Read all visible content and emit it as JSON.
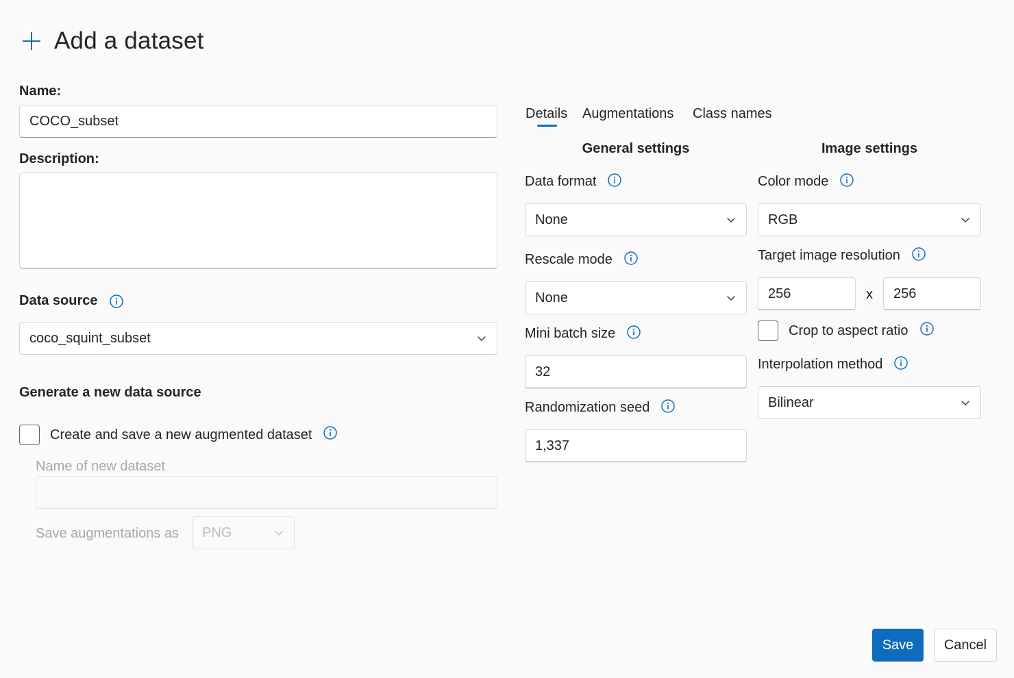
{
  "dialog": {
    "title": "Add a dataset",
    "icon": "plus-icon"
  },
  "left": {
    "name_label": "Name:",
    "name_value": "COCO_subset",
    "description_label": "Description:",
    "description_value": "",
    "data_source_label": "Data source",
    "data_source_value": "coco_squint_subset",
    "generate_heading": "Generate a new data source",
    "create_checkbox_label": "Create and save a new augmented dataset",
    "create_checkbox_checked": false,
    "new_name_label": "Name of new dataset",
    "new_name_value": "",
    "save_as_label": "Save augmentations as",
    "save_as_value": "PNG"
  },
  "tabs": [
    {
      "label": "Details",
      "selected": true
    },
    {
      "label": "Augmentations",
      "selected": false
    },
    {
      "label": "Class names",
      "selected": false
    }
  ],
  "general": {
    "heading": "General settings",
    "data_format_label": "Data format",
    "data_format_value": "None",
    "rescale_mode_label": "Rescale mode",
    "rescale_mode_value": "None",
    "mini_batch_label": "Mini batch size",
    "mini_batch_value": "32",
    "seed_label": "Randomization seed",
    "seed_value": "1,337"
  },
  "image": {
    "heading": "Image settings",
    "color_mode_label": "Color mode",
    "color_mode_value": "RGB",
    "resolution_label": "Target image resolution",
    "resolution_width": "256",
    "resolution_sep": "x",
    "resolution_height": "256",
    "crop_label": "Crop to aspect ratio",
    "crop_checked": false,
    "interp_label": "Interpolation method",
    "interp_value": "Bilinear"
  },
  "footer": {
    "save_label": "Save",
    "cancel_label": "Cancel"
  },
  "colors": {
    "accent": "#0f6cbd",
    "background": "#fafafa"
  }
}
